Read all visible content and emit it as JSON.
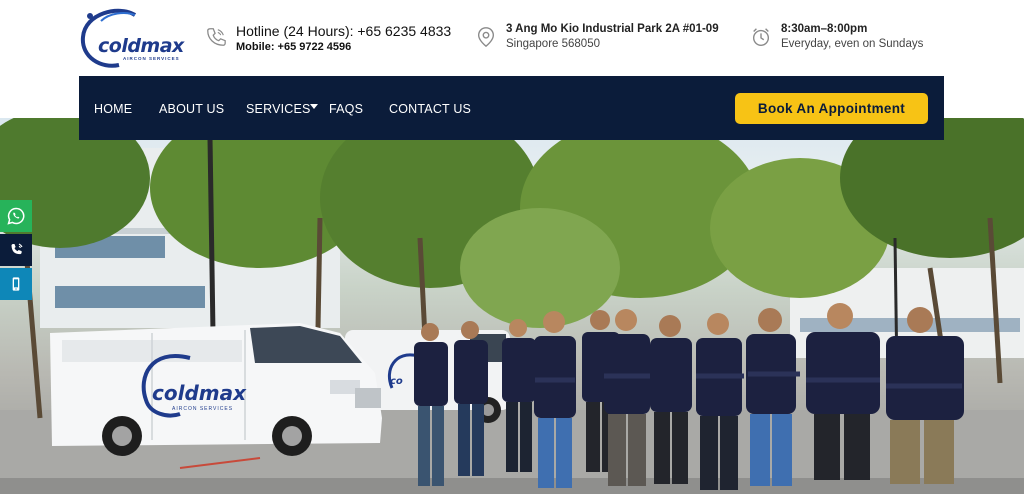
{
  "brand": {
    "logo_word": "coldmax",
    "logo_sub": "AIRCON SERVICES",
    "accent": "#1f3b8c"
  },
  "hotline": {
    "icon": "phone-icon",
    "title": "Hotline (24 Hours): +65 6235 4833",
    "mobile": "Mobile: +65 9722 4596"
  },
  "address": {
    "icon": "location-pin-icon",
    "line1": "3 Ang Mo Kio Industrial Park 2A #01-09",
    "line2": "Singapore 568050"
  },
  "hours": {
    "icon": "clock-icon",
    "line1": "8:30am–8:00pm",
    "line2": "Everyday, even on Sundays"
  },
  "nav": {
    "background": "#0b1c3a",
    "items": [
      {
        "label": "HOME"
      },
      {
        "label": "ABOUT US"
      },
      {
        "label": "SERVICES"
      },
      {
        "label": "FAQS"
      },
      {
        "label": "CONTACT US"
      }
    ],
    "cta": {
      "label": "Book An Appointment",
      "color": "#f7c315"
    }
  },
  "side_buttons": [
    {
      "icon": "whatsapp-icon",
      "color": "#27b35a"
    },
    {
      "icon": "call-icon",
      "color": "#0b1c3a"
    },
    {
      "icon": "mobile-icon",
      "color": "#0e87b8"
    }
  ],
  "hero": {
    "van_logo_word": "coldmax",
    "van_logo_sub": "AIRCON SERVICES",
    "team_size": 12
  }
}
